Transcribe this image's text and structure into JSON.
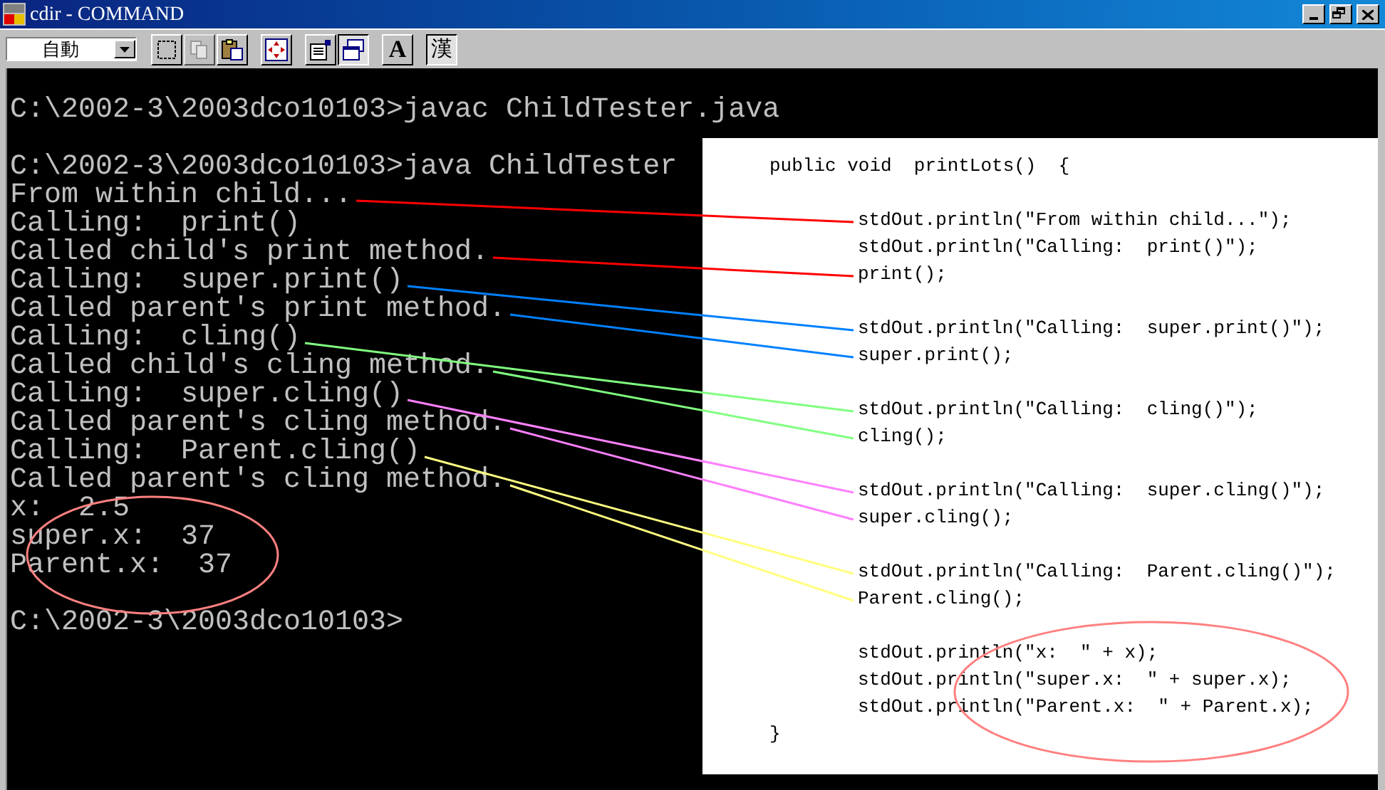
{
  "window": {
    "title": "cdir - COMMAND"
  },
  "toolbar": {
    "font_size": {
      "value": "自動"
    },
    "buttons": [
      {
        "kind": "mark",
        "pressed": false,
        "disabled": false
      },
      {
        "kind": "copy",
        "pressed": false,
        "disabled": true
      },
      {
        "kind": "paste",
        "pressed": false,
        "disabled": false
      },
      {
        "kind": "fullscreen",
        "pressed": false,
        "disabled": false
      },
      {
        "kind": "properties",
        "pressed": false,
        "disabled": false
      },
      {
        "kind": "background",
        "pressed": true,
        "disabled": false
      },
      {
        "kind": "font",
        "label": "A",
        "pressed": false,
        "disabled": false
      },
      {
        "kind": "ime",
        "label": "漢",
        "pressed": true,
        "disabled": false
      }
    ]
  },
  "console": {
    "blocks": [
      {
        "lines": [
          {
            "text": "C:\\2002-3\\2003dco10103>javac ChildTester.java"
          }
        ]
      },
      {
        "lines": [
          {
            "text": "C:\\2002-3\\2003dco10103>java ChildTester"
          },
          {
            "text": "From within child...",
            "color": "#ff0000"
          },
          {
            "text": "Calling:  print()"
          },
          {
            "text": "Called child's print method.",
            "color": "#ff0000"
          },
          {
            "text": "Calling:  super.print()",
            "color": "#0080ff"
          },
          {
            "text": "Called parent's print method.",
            "color": "#0080ff"
          },
          {
            "text": "Calling:  cling()",
            "color": "#80ff80"
          },
          {
            "text": "Called child's cling method.",
            "color": "#80ff80"
          },
          {
            "text": "Calling:  super.cling()",
            "color": "#ff80ff"
          },
          {
            "text": "Called parent's cling method.",
            "color": "#ff80ff"
          },
          {
            "text": "Calling:  Parent.cling()",
            "color": "#ffff80"
          },
          {
            "text": "Called parent's cling method.",
            "color": "#ffff80"
          },
          {
            "text": "x:  2.5"
          },
          {
            "text": "super.x:  37"
          },
          {
            "text": "Parent.x:  37"
          }
        ]
      },
      {
        "lines": [
          {
            "text": "C:\\2002-3\\2003dco10103>"
          }
        ]
      }
    ]
  },
  "code_panel": {
    "header": "public void  printLots()  {",
    "groups": [
      {
        "lines": [
          {
            "text": "stdOut.println(\"From within child...\");",
            "color": "#ff0000"
          },
          {
            "text": "stdOut.println(\"Calling:  print()\");"
          },
          {
            "text": "print();",
            "color": "#ff0000"
          }
        ]
      },
      {
        "lines": [
          {
            "text": "stdOut.println(\"Calling:  super.print()\");",
            "color": "#0080ff"
          },
          {
            "text": "super.print();",
            "color": "#0080ff"
          }
        ]
      },
      {
        "lines": [
          {
            "text": "stdOut.println(\"Calling:  cling()\");",
            "color": "#80ff80"
          },
          {
            "text": "cling();",
            "color": "#80ff80"
          }
        ]
      },
      {
        "lines": [
          {
            "text": "stdOut.println(\"Calling:  super.cling()\");",
            "color": "#ff80ff"
          },
          {
            "text": "super.cling();",
            "color": "#ff80ff"
          }
        ]
      },
      {
        "lines": [
          {
            "text": "stdOut.println(\"Calling:  Parent.cling()\");",
            "color": "#ffff80"
          },
          {
            "text": "Parent.cling();",
            "color": "#ffff80"
          }
        ]
      },
      {
        "lines": [
          {
            "text": "stdOut.println(\"x:  \" + x);"
          },
          {
            "text": "stdOut.println(\"super.x:  \" + super.x);"
          },
          {
            "text": "stdOut.println(\"Parent.x:  \" + Parent.x);"
          }
        ]
      }
    ],
    "footer": "}"
  }
}
